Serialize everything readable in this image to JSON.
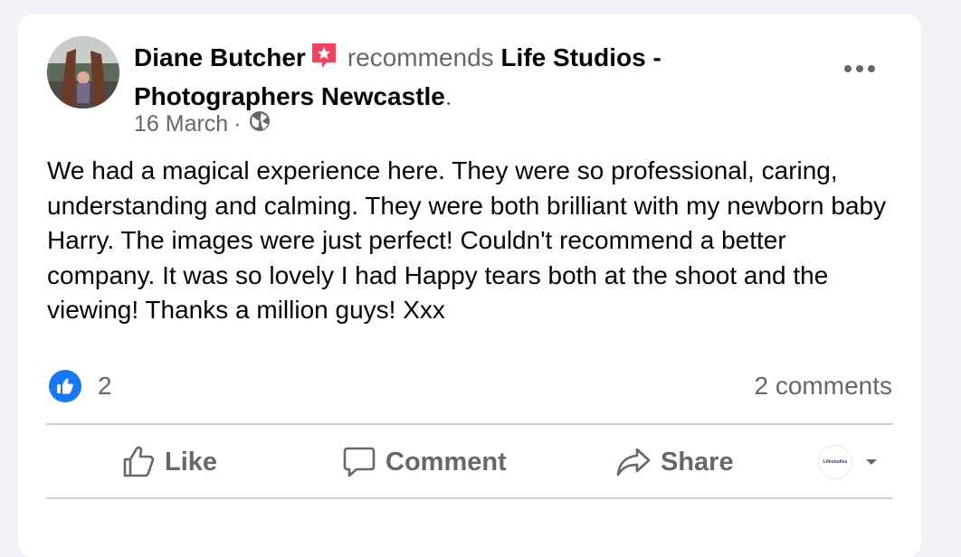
{
  "post": {
    "author": "Diane Butcher",
    "verb": "recommends",
    "page_name": "Life Studios - Photographers Newcastle",
    "period": ".",
    "date": "16 March",
    "separator": "·",
    "audience_icon": "globe-icon",
    "badge_icon": "recommendation-star-icon",
    "body": "We had a magical experience here. They were so professional, caring, understanding and calming. They were both brilliant with my newborn baby Harry. The images were just perfect! Couldn't recommend a better company. It was so lovely I had Happy tears both at the shoot and the viewing! Thanks a million guys! Xxx"
  },
  "reactions": {
    "icon": "thumbs-up-icon",
    "count": "2",
    "comments": "2 comments"
  },
  "actions": {
    "like": "Like",
    "comment": "Comment",
    "share": "Share"
  },
  "page_selector": {
    "logo_text": "Lifestudios"
  },
  "colors": {
    "accent": "#1877f2",
    "muted": "#65676b",
    "badge": "#f3425f",
    "divider": "#ced0d4"
  }
}
